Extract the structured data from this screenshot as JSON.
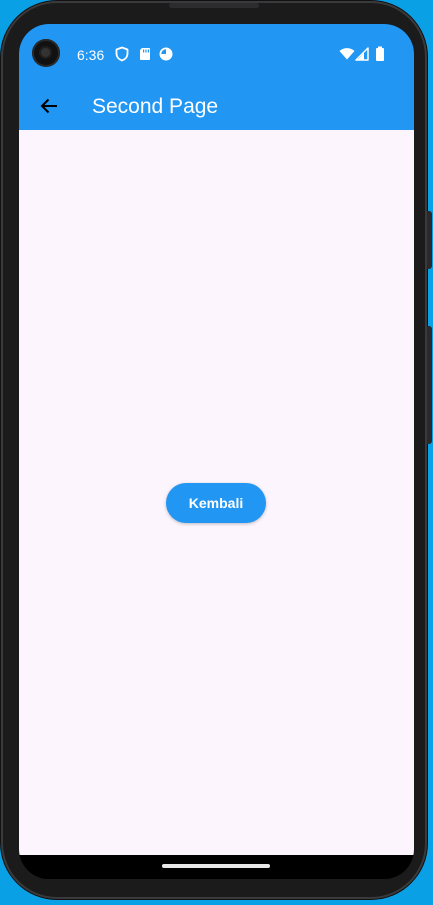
{
  "status_bar": {
    "time": "6:36",
    "left_icons": [
      "shield-icon",
      "sd-card-icon",
      "data-saver-icon"
    ],
    "right_icons": [
      "wifi-icon",
      "signal-icon",
      "battery-icon"
    ],
    "color": "#2196f3"
  },
  "app_bar": {
    "title": "Second Page",
    "back_icon": "arrow-back-icon",
    "background": "#2196f3"
  },
  "main": {
    "background": "#fcf5fe",
    "button_label": "Kembali",
    "button_color": "#2196f3"
  }
}
